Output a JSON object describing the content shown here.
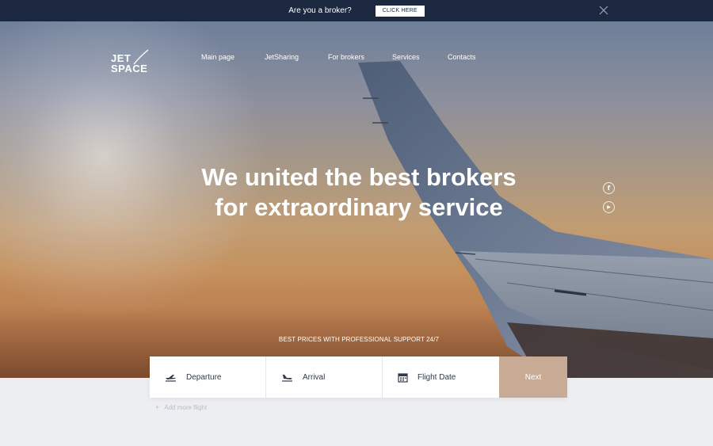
{
  "topbar": {
    "question": "Are you a broker?",
    "cta_label": "CLICK HERE",
    "close_icon": "close-icon"
  },
  "logo": {
    "line1": "JET",
    "line2": "SPACE"
  },
  "nav": {
    "items": [
      {
        "label": "Main page"
      },
      {
        "label": "JetSharing"
      },
      {
        "label": "For brokers"
      },
      {
        "label": "Services"
      },
      {
        "label": "Contacts"
      }
    ]
  },
  "hero": {
    "title_line1": "We united the best brokers",
    "title_line2": "for extraordinary service",
    "tagline": "BEST PRICES WITH PROFESSIONAL SUPPORT 24/7"
  },
  "social": [
    {
      "name": "facebook-icon",
      "glyph": "f"
    },
    {
      "name": "youtube-icon",
      "glyph": "▶"
    }
  ],
  "search": {
    "departure_label": "Departure",
    "arrival_label": "Arrival",
    "date_label": "Flight Date",
    "next_label": "Next"
  },
  "add_flight": {
    "label": "Add more flight",
    "icon": "+"
  },
  "colors": {
    "topbar_bg": "#1c2840",
    "accent": "#c8ab95",
    "text_dark": "#2f3a4c",
    "page_bg": "#eceef1"
  }
}
